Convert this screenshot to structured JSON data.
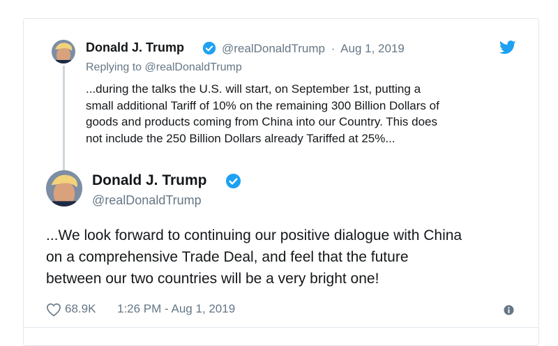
{
  "parent_tweet": {
    "author_name": "Donald J. Trump",
    "handle": "@realDonaldTrump",
    "separator": "·",
    "date": "Aug 1, 2019",
    "replying_to": "Replying to @realDonaldTrump",
    "text_lines": [
      "...during the talks the U.S. will start, on September 1st, putting a",
      "small additional Tariff of 10% on the remaining 300 Billion Dollars of",
      "goods and products coming from China into our Country. This does",
      "not include the 250 Billion Dollars already Tariffed at 25%..."
    ]
  },
  "main_tweet": {
    "author_name": "Donald J. Trump",
    "handle": "@realDonaldTrump",
    "text_lines": [
      "...We look forward to continuing our positive dialogue with China",
      "on a comprehensive Trade Deal, and feel that the future",
      "between our two countries will be a very bright one!"
    ],
    "likes": "68.9K",
    "timestamp": "1:26 PM - Aug 1, 2019"
  },
  "icons": {
    "verified": "verified-badge-icon",
    "brand": "twitter-bird-icon",
    "like": "heart-icon",
    "info": "info-icon"
  },
  "colors": {
    "twitter_blue": "#1da1f2",
    "secondary_text": "#657786",
    "border": "#e1e8ed"
  }
}
